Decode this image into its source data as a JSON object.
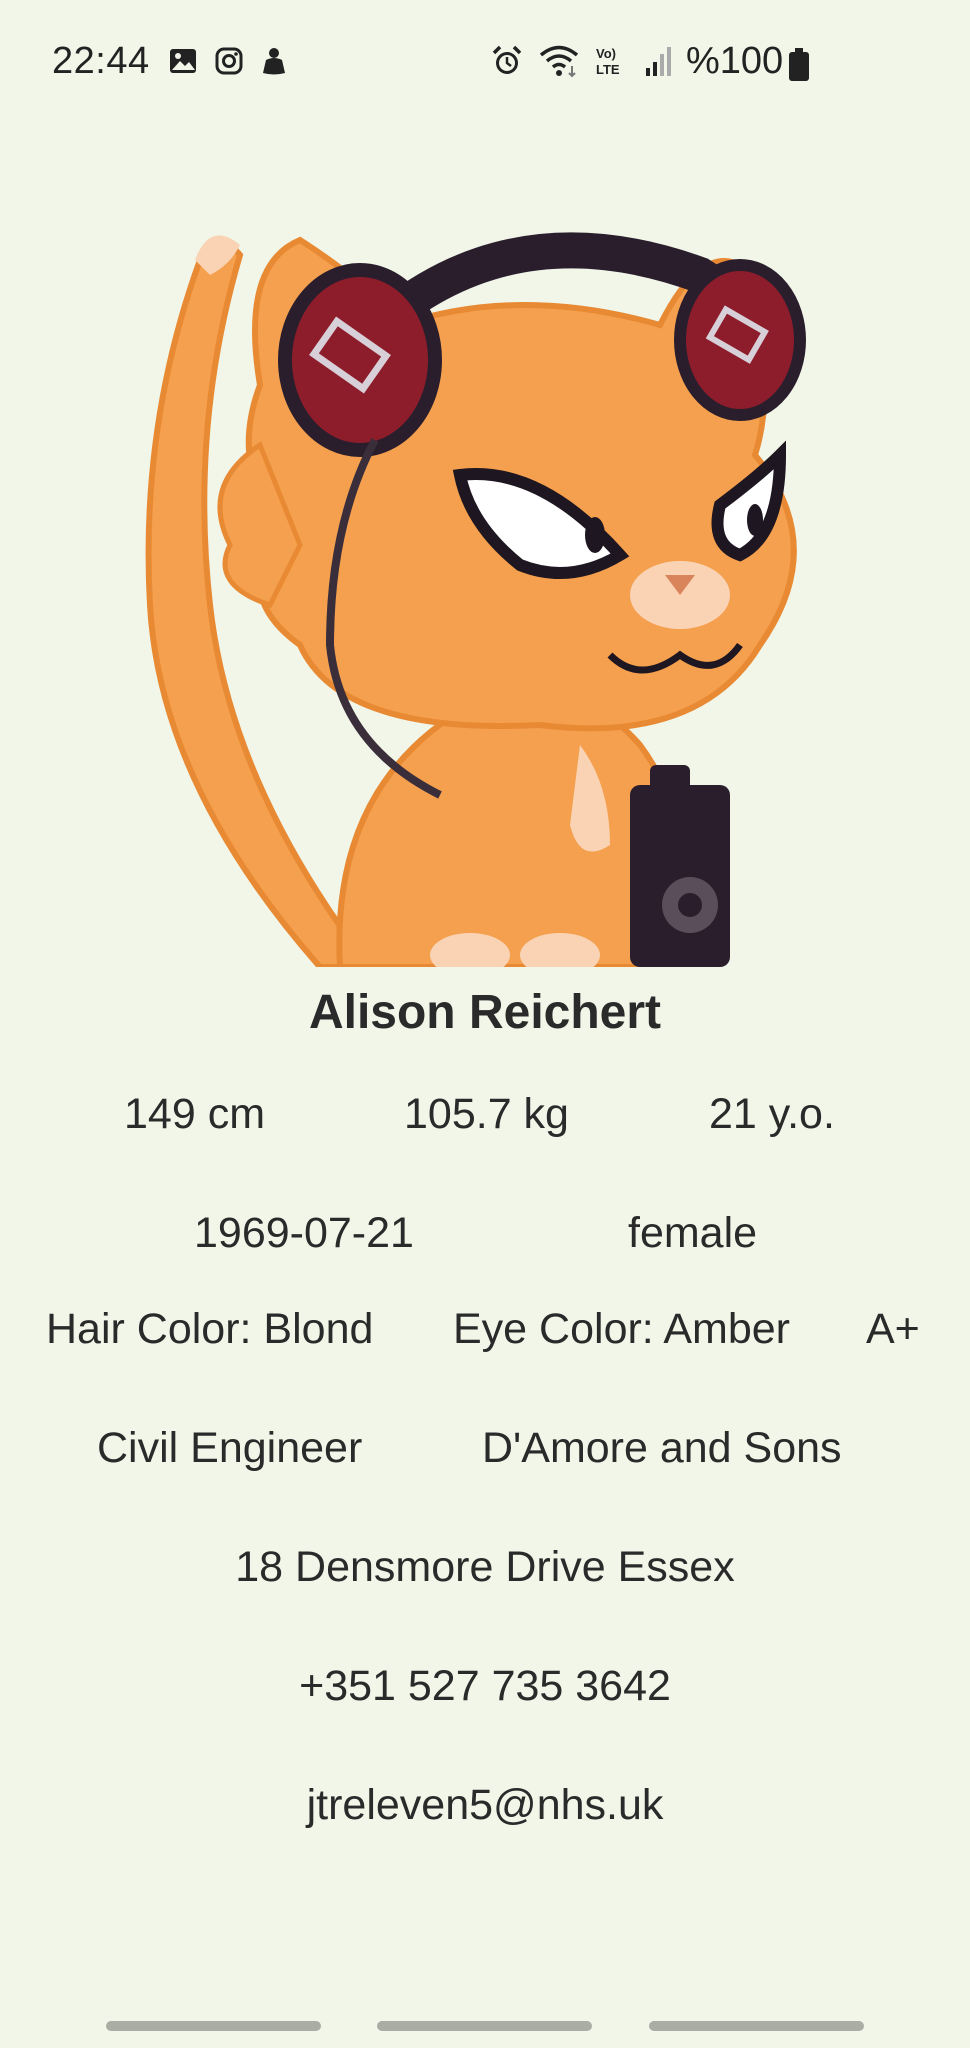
{
  "status_bar": {
    "time": "22:44",
    "battery_percent": "%100",
    "left_icons": [
      "gallery-icon",
      "instagram-icon",
      "person-icon"
    ],
    "right_icons": [
      "alarm-icon",
      "wifi-icon",
      "volte-icon",
      "signal-icon"
    ]
  },
  "profile": {
    "avatar": "cat-with-headphones",
    "name": "Alison Reichert",
    "height": "149 cm",
    "weight": "105.7 kg",
    "age": "21 y.o.",
    "birth_date": "1969-07-21",
    "gender": "female",
    "hair_color": "Hair Color: Blond",
    "eye_color": "Eye Color: Amber",
    "blood_type": "A+",
    "job_title": "Civil Engineer",
    "company": "D'Amore and Sons",
    "address": "18 Densmore Drive Essex",
    "phone": "+351 527 735 3642",
    "email": "jtreleven5@nhs.uk"
  },
  "colors": {
    "background": "#f1f6e9",
    "text": "#2a2a2a",
    "nav_bar": "#a9ada4"
  }
}
